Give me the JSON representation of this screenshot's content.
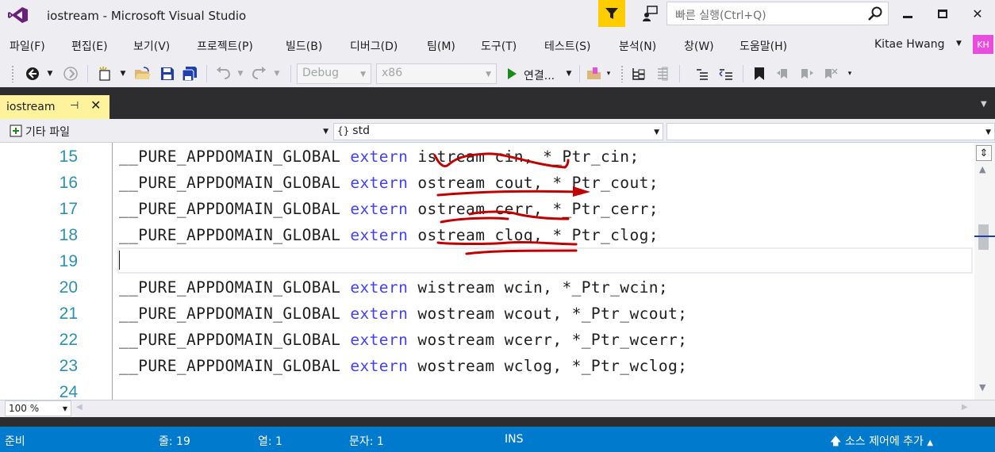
{
  "window": {
    "title": "iostream - Microsoft Visual Studio",
    "quick_launch_placeholder": "빠른 실행(Ctrl+Q)",
    "minimize_glyph": "▬",
    "maximize_glyph": "□",
    "close_glyph": "✕"
  },
  "menu": {
    "items": [
      "파일(F)",
      "편집(E)",
      "보기(V)",
      "프로젝트(P)",
      "빌드(B)",
      "디버그(D)",
      "팀(M)",
      "도구(T)",
      "테스트(S)",
      "분석(N)",
      "창(W)",
      "도움말(H)"
    ],
    "user_name": "Kitae Hwang",
    "user_initials": "KH"
  },
  "toolbar": {
    "configuration": "Debug",
    "platform": "x86",
    "connect_label": "연결...",
    "icons": [
      "back-icon",
      "forward-icon",
      "new-project-icon",
      "open-file-icon",
      "save-icon",
      "save-all-icon",
      "undo-icon",
      "redo-icon",
      "start-icon",
      "browse-icon",
      "indent-icon",
      "outdent-icon",
      "comment-icon",
      "uncomment-icon",
      "bookmark-icon",
      "prev-bookmark-icon",
      "next-bookmark-icon",
      "clear-bookmark-icon"
    ]
  },
  "document_tab": {
    "label": "iostream",
    "pin_glyph": "⊣",
    "close_glyph": "✕"
  },
  "navbar": {
    "project_scope": "기타 파일",
    "namespace_scope": "std",
    "member_scope": ""
  },
  "editor": {
    "current_line": 19,
    "lines": [
      {
        "no": "15",
        "macro": "__PURE_APPDOMAIN_GLOBAL ",
        "keyword": "extern",
        "rest": " istream cin, *_Ptr_cin;"
      },
      {
        "no": "16",
        "macro": "__PURE_APPDOMAIN_GLOBAL ",
        "keyword": "extern",
        "rest": " ostream cout, *_Ptr_cout;"
      },
      {
        "no": "17",
        "macro": "__PURE_APPDOMAIN_GLOBAL ",
        "keyword": "extern",
        "rest": " ostream cerr, *_Ptr_cerr;"
      },
      {
        "no": "18",
        "macro": "__PURE_APPDOMAIN_GLOBAL ",
        "keyword": "extern",
        "rest": " ostream clog, *_Ptr_clog;"
      },
      {
        "no": "19",
        "macro": "",
        "keyword": "",
        "rest": ""
      },
      {
        "no": "20",
        "macro": "__PURE_APPDOMAIN_GLOBAL ",
        "keyword": "extern",
        "rest": " wistream wcin, *_Ptr_wcin;"
      },
      {
        "no": "21",
        "macro": "__PURE_APPDOMAIN_GLOBAL ",
        "keyword": "extern",
        "rest": " wostream wcout, *_Ptr_wcout;"
      },
      {
        "no": "22",
        "macro": "__PURE_APPDOMAIN_GLOBAL ",
        "keyword": "extern",
        "rest": " wostream wcerr, *_Ptr_wcerr;"
      },
      {
        "no": "23",
        "macro": "__PURE_APPDOMAIN_GLOBAL ",
        "keyword": "extern",
        "rest": " wostream wclog, *_Ptr_wclog;"
      },
      {
        "no": "24",
        "macro": "",
        "keyword": "",
        "rest": ""
      }
    ],
    "annotation_color": "#C00000",
    "keyword_color": "#0000FF",
    "line_number_color": "#2B91AF"
  },
  "zoom": {
    "value": "100 %"
  },
  "statusbar": {
    "ready": "준비",
    "line": "줄: 19",
    "column": "열: 1",
    "char": "문자: 1",
    "mode": "INS",
    "source_control": "소스 제어에 추가",
    "background": "#007ACC"
  }
}
